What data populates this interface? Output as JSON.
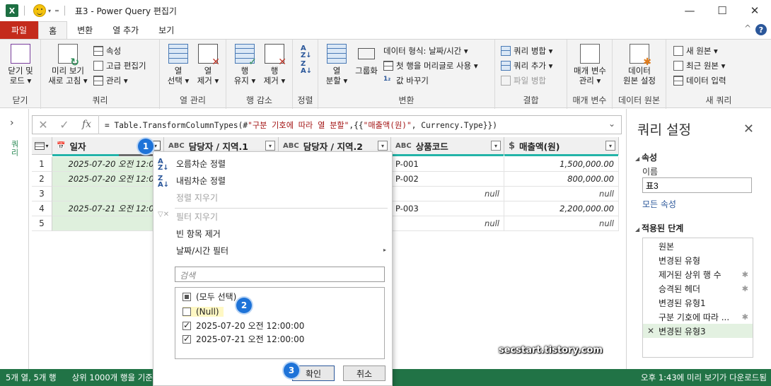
{
  "window": {
    "app_icon": "X",
    "title": "표3 - Power Query 편집기",
    "minimize": "—",
    "maximize": "☐",
    "close": "✕"
  },
  "tabs": [
    {
      "label": "파일"
    },
    {
      "label": "홈"
    },
    {
      "label": "변환"
    },
    {
      "label": "열 추가"
    },
    {
      "label": "보기"
    }
  ],
  "help": "?",
  "ribbon": {
    "close_group": {
      "label": "닫기",
      "close_load": "닫기 및\n로드 ▾"
    },
    "query_group": {
      "label": "쿼리",
      "refresh_preview": "미리 보기\n새로 고침 ▾",
      "properties": "속성",
      "advanced_editor": "고급 편집기",
      "manage": "관리 ▾"
    },
    "column_manage": {
      "label": "열 관리",
      "choose_columns": "열\n선택 ▾",
      "remove_columns": "열\n제거 ▾"
    },
    "row_reduce": {
      "label": "행 감소",
      "keep_rows": "행\n유지 ▾",
      "remove_rows": "행\n제거 ▾"
    },
    "sort": {
      "label": "정렬"
    },
    "transform": {
      "label": "변환",
      "split_column": "열\n분할 ▾",
      "group_by": "그룹화",
      "data_type": "데이터 형식: 날짜/시간 ▾",
      "first_row_header": "첫 행을 머리글로 사용 ▾",
      "replace_values": "값 바꾸기"
    },
    "combine": {
      "label": "결합",
      "merge_queries": "쿼리 병합 ▾",
      "append_queries": "쿼리 추가 ▾",
      "combine_files": "파일 병합"
    },
    "parameters": {
      "label": "매개 변수",
      "manage_parameters": "매개 변수\n관리 ▾"
    },
    "data_source": {
      "label": "데이터 원본",
      "data_source_settings": "데이터\n원본 설정"
    },
    "new_query": {
      "label": "새 쿼리",
      "new_source": "새 원본 ▾",
      "recent_sources": "최근 원본 ▾",
      "enter_data": "데이터 입력"
    }
  },
  "left_panel": {
    "label": "쿼리",
    "expand": "›"
  },
  "formula_bar": {
    "cancel": "✕",
    "commit": "✓",
    "fx": "fx",
    "formula_prefix": "= Table.TransformColumnTypes(#",
    "formula_str1": "\"구분 기호에 따라 열 분할\"",
    "formula_mid": ",{{",
    "formula_str2": "\"매출액(원)\"",
    "formula_suffix": ", Currency.Type}})",
    "expand": "⌄"
  },
  "grid": {
    "columns": [
      {
        "name": "일자",
        "type": "📅"
      },
      {
        "name": "담당자 / 지역.1",
        "type": "ABC"
      },
      {
        "name": "담당자 / 지역.2",
        "type": "ABC"
      },
      {
        "name": "상품코드",
        "type": "ABC"
      },
      {
        "name": "매출액(원)",
        "type": "$"
      }
    ],
    "rows": [
      {
        "no": "1",
        "date": "2025-07-20 오전 12:00",
        "product": "P-001",
        "amount": "1,500,000.00"
      },
      {
        "no": "2",
        "date": "2025-07-20 오전 12:00",
        "product": "P-002",
        "amount": "800,000.00"
      },
      {
        "no": "3",
        "date": "n",
        "product": "",
        "product_null": "null",
        "amount": "null"
      },
      {
        "no": "4",
        "date": "2025-07-21 오전 12:00",
        "product": "P-003",
        "amount": "2,200,000.00"
      },
      {
        "no": "5",
        "date": "n",
        "product": "",
        "product_null": "null",
        "amount": "null"
      }
    ]
  },
  "filter_menu": {
    "sort_asc": "오름차순 정렬",
    "sort_desc": "내림차순 정렬",
    "clear_sort": "정렬 지우기",
    "clear_filter": "필터 지우기",
    "remove_empty": "빈 항목 제거",
    "datetime_filters": "날짜/시간 필터",
    "search_placeholder": "검색",
    "items": [
      {
        "label": "(모두 선택)",
        "state": "mixed"
      },
      {
        "label": "(Null)",
        "state": "unchecked"
      },
      {
        "label": "2025-07-20 오전 12:00:00",
        "state": "checked"
      },
      {
        "label": "2025-07-21 오전 12:00:00",
        "state": "checked"
      }
    ],
    "ok": "확인",
    "cancel": "취소"
  },
  "badges": [
    "1",
    "2",
    "3"
  ],
  "query_settings": {
    "title": "쿼리 설정",
    "close": "✕",
    "properties_header": "속성",
    "name_label": "이름",
    "name_value": "표3",
    "all_properties": "모든 속성",
    "applied_steps_header": "적용된 단계",
    "steps": [
      {
        "label": "원본",
        "gear": false
      },
      {
        "label": "변경된 유형",
        "gear": false
      },
      {
        "label": "제거된 상위 행 수",
        "gear": true
      },
      {
        "label": "승격된 헤더",
        "gear": true
      },
      {
        "label": "변경된 유형1",
        "gear": false
      },
      {
        "label": "구분 기호에 따라 ...",
        "gear": true
      },
      {
        "label": "변경된 유형3",
        "gear": false,
        "active": true
      }
    ]
  },
  "status": {
    "summary": "5개 열, 5개 행",
    "profile": "상위 1000개 행을 기준으로",
    "download": "오후 1:43에 미리 보기가 다운로드됨"
  },
  "watermark": "secstart.tistory.com",
  "colors": {
    "excel_green": "#217346",
    "file_tab": "#c42b1c",
    "badge_blue": "#1e73d8",
    "quality_bar": "#23b4a8"
  }
}
